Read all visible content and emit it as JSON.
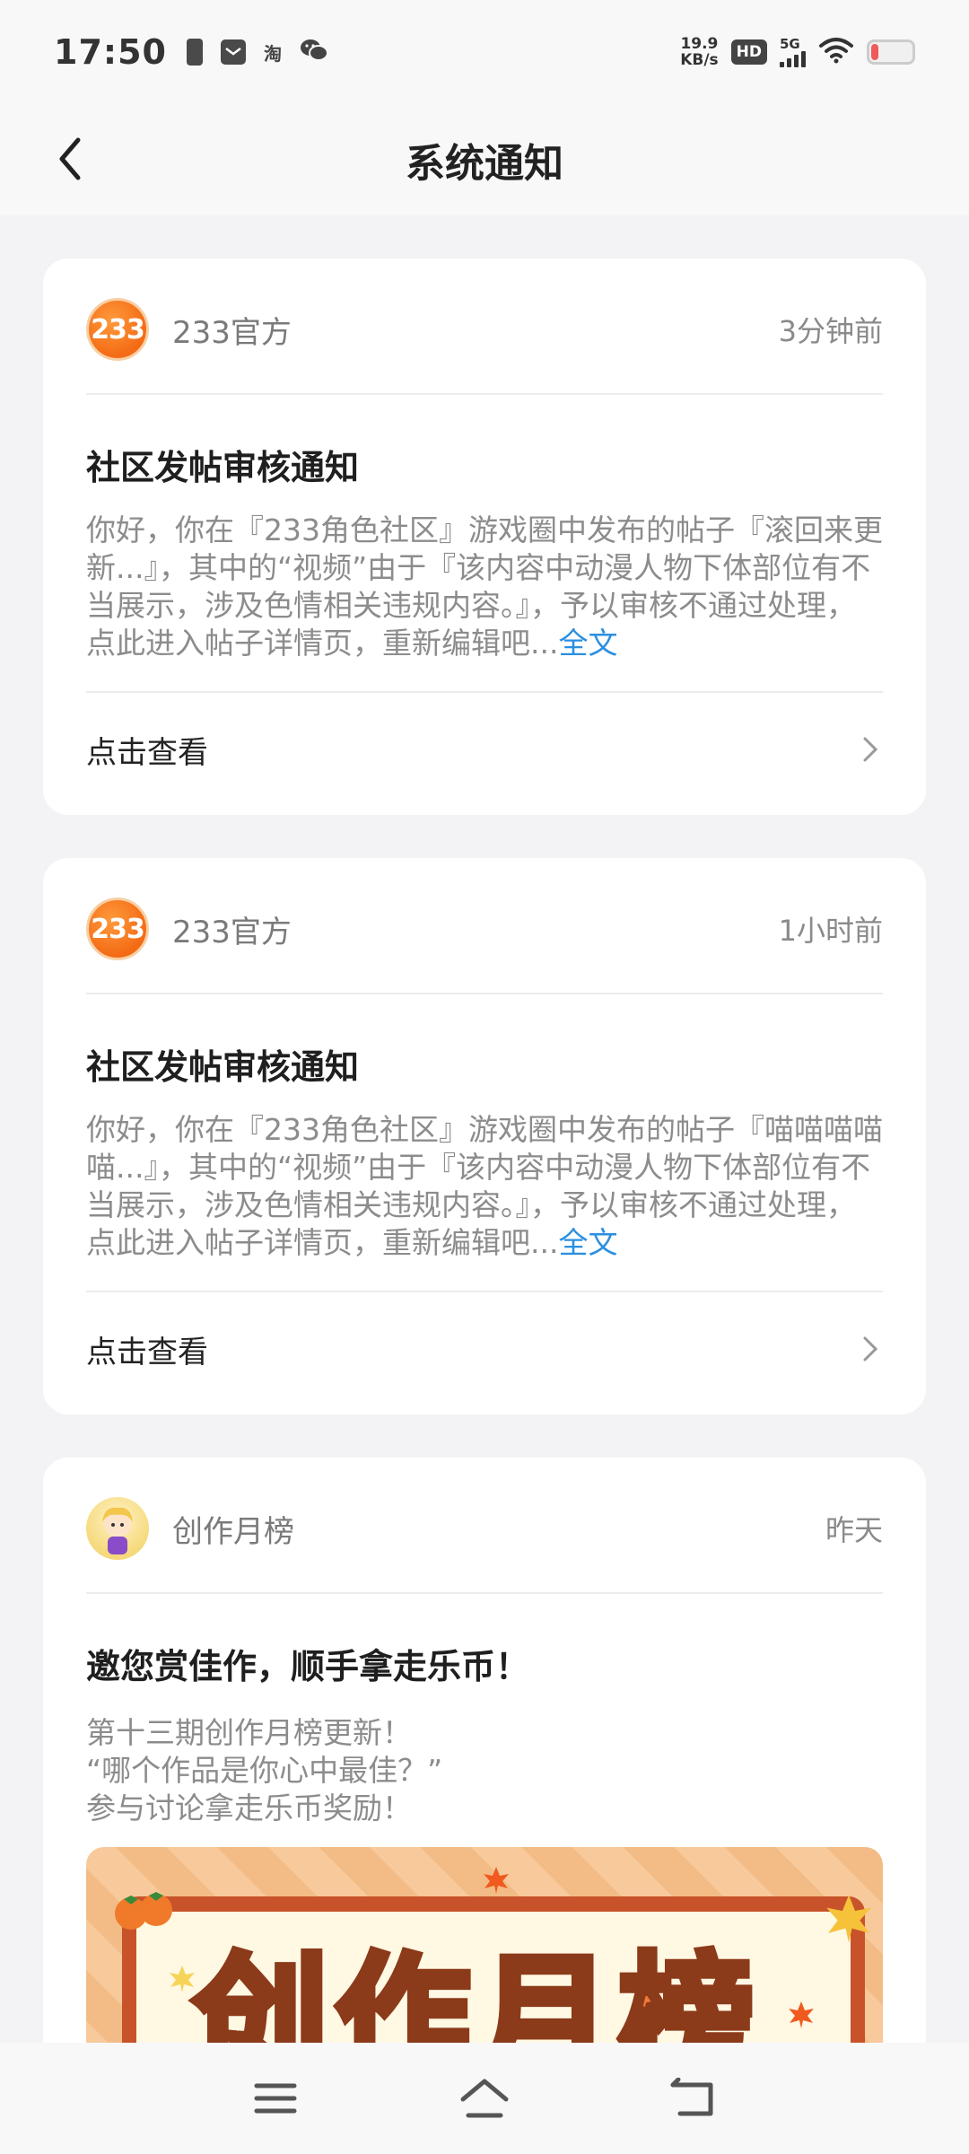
{
  "status_bar": {
    "time": "17:50",
    "icon_taobao_text": "淘",
    "net_speed_value": "19.9",
    "net_speed_unit": "KB/s",
    "hd_badge": "HD",
    "network_type": "5G",
    "battery_level": 0.12,
    "battery_color": "#f05a5a"
  },
  "header": {
    "title": "系统通知"
  },
  "notifications": [
    {
      "avatar_text": "233",
      "sender": "233官方",
      "time": "3分钟前",
      "title": "社区发帖审核通知",
      "body": "你好，你在『233角色社区』游戏圈中发布的帖子『滚回来更新...』，其中的“视频”由于『该内容中动漫人物下体部位有不当展示，涉及色情相关违规内容。』，予以审核不通过处理，点此进入帖子详情页，重新编辑吧...",
      "more_link": "全文",
      "action_label": "点击查看"
    },
    {
      "avatar_text": "233",
      "sender": "233官方",
      "time": "1小时前",
      "title": "社区发帖审核通知",
      "body": "你好，你在『233角色社区』游戏圈中发布的帖子『喵喵喵喵喵...』，其中的“视频”由于『该内容中动漫人物下体部位有不当展示，涉及色情相关违规内容。』，予以审核不通过处理，点此进入帖子详情页，重新编辑吧...",
      "more_link": "全文",
      "action_label": "点击查看"
    },
    {
      "sender": "创作月榜",
      "time": "昨天",
      "title": "邀您赏佳作，顺手拿走乐币！",
      "body_lines": [
        "第十三期创作月榜更新！",
        "“哪个作品是你心中最佳？”",
        "参与讨论拿走乐币奖励！"
      ],
      "banner_text": "创作月榜"
    }
  ],
  "colors": {
    "accent_link": "#2b8fe0",
    "brand_orange": "#f36b14",
    "page_bg": "#f3f3f5"
  }
}
